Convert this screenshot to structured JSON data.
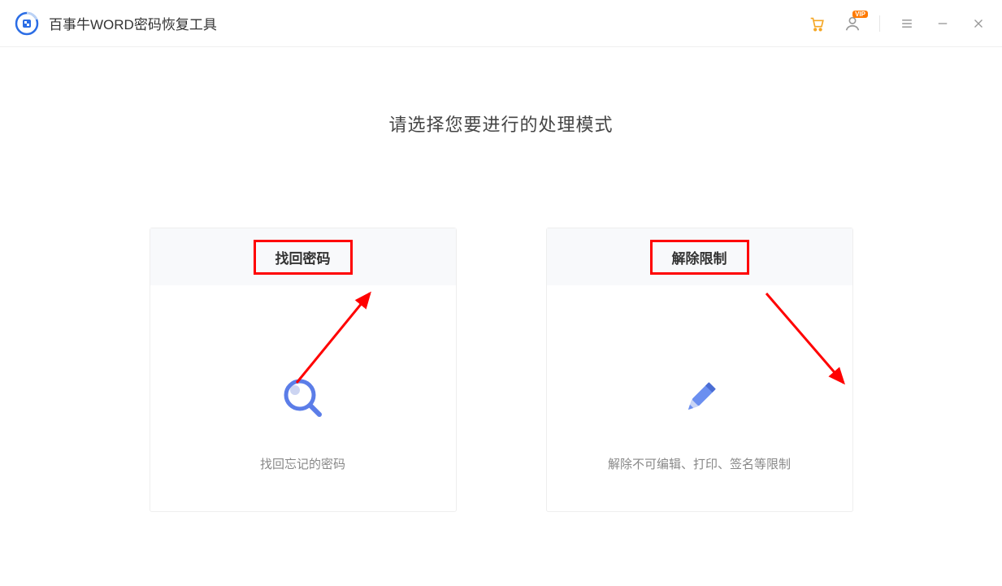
{
  "header": {
    "title": "百事牛WORD密码恢复工具"
  },
  "main": {
    "prompt": "请选择您要进行的处理模式",
    "cards": [
      {
        "title": "找回密码",
        "description": "找回忘记的密码"
      },
      {
        "title": "解除限制",
        "description": "解除不可编辑、打印、签名等限制"
      }
    ]
  },
  "annotations": {
    "highlight_color": "#ff0000"
  }
}
